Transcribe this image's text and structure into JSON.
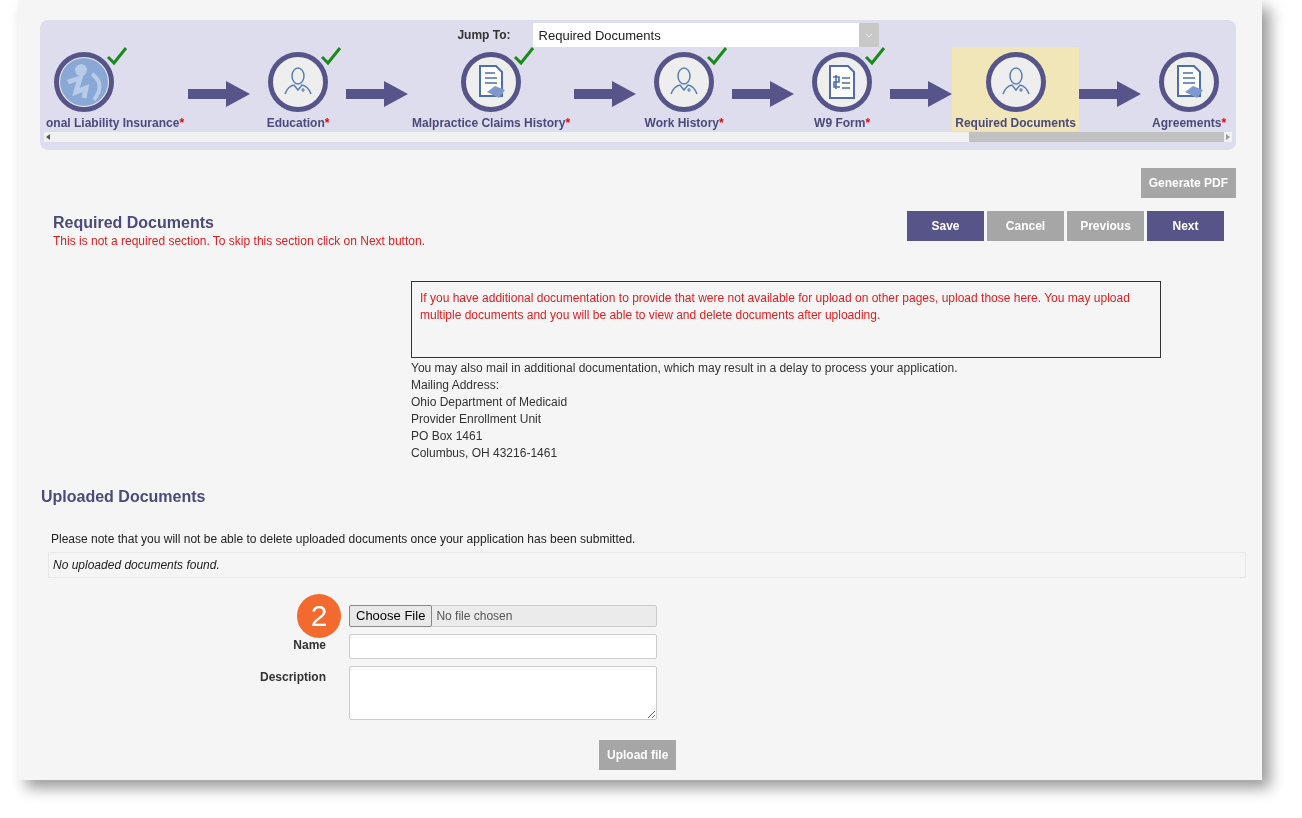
{
  "jump_to": {
    "label": "Jump To:",
    "value": "Required Documents"
  },
  "steps": [
    {
      "label": "onal Liability Insurance",
      "marker": "*",
      "completed": true,
      "selected": false
    },
    {
      "label": "Education",
      "marker": "*",
      "completed": true,
      "selected": false
    },
    {
      "label": "Malpractice Claims History",
      "marker": "*",
      "completed": true,
      "selected": false
    },
    {
      "label": "Work History",
      "marker": "*",
      "completed": true,
      "selected": false
    },
    {
      "label": "W9 Form",
      "marker": "*",
      "completed": true,
      "selected": false
    },
    {
      "label": "Required Documents",
      "completed": false,
      "selected": true
    },
    {
      "label": "Agreements",
      "marker": "*",
      "completed": false,
      "selected": false
    }
  ],
  "generate_pdf": "Generate PDF",
  "section": {
    "title": "Required Documents",
    "note": "This is not a required section. To skip this section click on Next button."
  },
  "nav_buttons": [
    {
      "label": "Save",
      "kind": "primary"
    },
    {
      "label": "Cancel",
      "kind": "secondary"
    },
    {
      "label": "Previous",
      "kind": "secondary"
    },
    {
      "label": "Next",
      "kind": "primary"
    }
  ],
  "notice": "If you have additional documentation to provide that were not available for upload on other pages, upload those here. You may upload multiple documents and you will be able to view and delete documents after uploading.",
  "mail_info": [
    "You may also mail in additional documentation, which may result in a delay to process your application.",
    "Mailing Address:",
    "Ohio Department of Medicaid",
    "Provider Enrollment Unit",
    "PO Box 1461",
    "Columbus, OH 43216-1461"
  ],
  "uploaded": {
    "title": "Uploaded Documents",
    "note": "Please note that you will not be able to delete uploaded documents once your application has been submitted.",
    "empty_message": "No uploaded documents found."
  },
  "upload_form": {
    "step_badge": "2",
    "file_button": "Choose File",
    "file_status": "No file chosen",
    "fields": [
      {
        "label": "Name",
        "kind": "text"
      },
      {
        "label": "Description",
        "kind": "textarea"
      }
    ],
    "submit": "Upload file"
  }
}
